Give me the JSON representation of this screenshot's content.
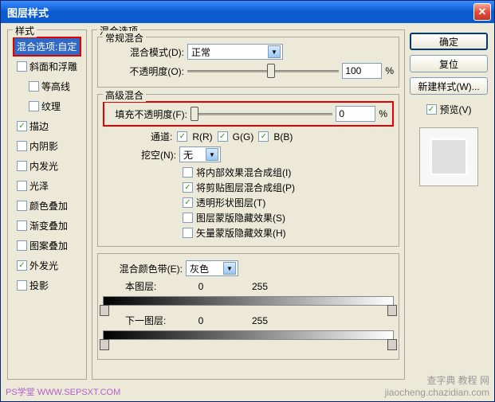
{
  "window": {
    "title": "图层样式"
  },
  "styles": {
    "legend": "样式",
    "items": [
      {
        "label": "混合选项:自定",
        "checked": null,
        "selected": true,
        "indent": false
      },
      {
        "label": "斜面和浮雕",
        "checked": false,
        "indent": false
      },
      {
        "label": "等高线",
        "checked": false,
        "indent": true
      },
      {
        "label": "纹理",
        "checked": false,
        "indent": true
      },
      {
        "label": "描边",
        "checked": true,
        "indent": false
      },
      {
        "label": "内阴影",
        "checked": false,
        "indent": false
      },
      {
        "label": "内发光",
        "checked": false,
        "indent": false
      },
      {
        "label": "光泽",
        "checked": false,
        "indent": false
      },
      {
        "label": "颜色叠加",
        "checked": false,
        "indent": false
      },
      {
        "label": "渐变叠加",
        "checked": false,
        "indent": false
      },
      {
        "label": "图案叠加",
        "checked": false,
        "indent": false
      },
      {
        "label": "外发光",
        "checked": true,
        "indent": false
      },
      {
        "label": "投影",
        "checked": false,
        "indent": false
      }
    ]
  },
  "blend": {
    "legend": "混合选项",
    "normal_legend": "常规混合",
    "mode_label": "混合模式(D):",
    "mode_value": "正常",
    "opacity_label": "不透明度(O):",
    "opacity_value": "100",
    "percent": "%",
    "advanced_legend": "高级混合",
    "fill_label": "填充不透明度(F):",
    "fill_value": "0",
    "channel_label": "通道:",
    "channels": {
      "r": "R(R)",
      "g": "G(G)",
      "b": "B(B)"
    },
    "knockout_label": "挖空(N):",
    "knockout_value": "无",
    "cb1": "将内部效果混合成组(I)",
    "cb2": "将剪贴图层混合成组(P)",
    "cb3": "透明形状图层(T)",
    "cb4": "图层蒙版隐藏效果(S)",
    "cb5": "矢量蒙版隐藏效果(H)",
    "blendif_label": "混合颜色带(E):",
    "blendif_value": "灰色",
    "this_layer": "本图层:",
    "under_layer": "下一图层:",
    "v0": "0",
    "v255": "255"
  },
  "buttons": {
    "ok": "确定",
    "cancel": "复位",
    "new_style": "新建样式(W)...",
    "preview": "预览(V)"
  },
  "watermarks": {
    "left": "PS学堂  WWW.SEPSXT.COM",
    "right": "查字典  教程 网\njiaocheng.chazidian.com"
  }
}
